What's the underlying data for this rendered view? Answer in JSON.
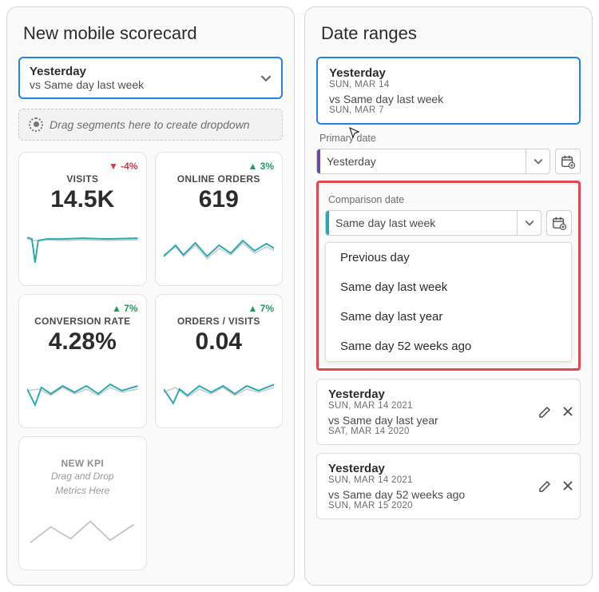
{
  "left": {
    "title": "New mobile scorecard",
    "picker_line1": "Yesterday",
    "picker_line2": "vs Same day last week",
    "dropzone": "Drag segments here to create dropdown",
    "cards": [
      {
        "delta": "-4%",
        "dir": "down",
        "label": "VISITS",
        "value": "14.5K"
      },
      {
        "delta": "3%",
        "dir": "up",
        "label": "ONLINE ORDERS",
        "value": "619"
      },
      {
        "delta": "7%",
        "dir": "up",
        "label": "CONVERSION RATE",
        "value": "4.28%"
      },
      {
        "delta": "7%",
        "dir": "up",
        "label": "ORDERS / VISITS",
        "value": "0.04"
      }
    ],
    "placeholder": {
      "label": "NEW KPI",
      "sub1": "Drag and Drop",
      "sub2": "Metrics Here"
    }
  },
  "right": {
    "title": "Date ranges",
    "active": {
      "title": "Yesterday",
      "sub1": "SUN, MAR 14",
      "cmp": "vs Same day last week",
      "sub2": "SUN, MAR 7"
    },
    "primary_label": "Primary date",
    "primary_value": "Yesterday",
    "compare_label": "Comparison date",
    "compare_value": "Same day last week",
    "menu": [
      "Previous day",
      "Same day last week",
      "Same day last year",
      "Same day 52 weeks ago"
    ],
    "others": [
      {
        "title": "Yesterday",
        "sub1": "SUN, MAR 14 2021",
        "cmp": "vs Same day last year",
        "sub2": "SAT, MAR 14 2020"
      },
      {
        "title": "Yesterday",
        "sub1": "SUN, MAR 14 2021",
        "cmp": "vs Same day 52 weeks ago",
        "sub2": "SUN, MAR 15 2020"
      }
    ]
  }
}
